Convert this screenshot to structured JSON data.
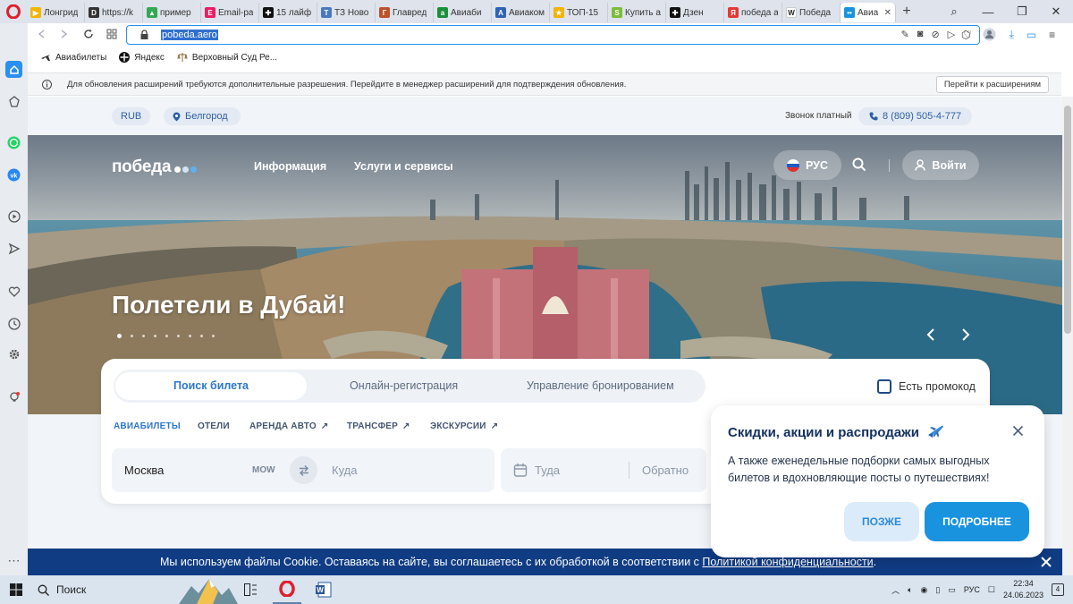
{
  "browser": {
    "tabs": [
      {
        "label": "Лонгрид",
        "icon_color": "#f4b400",
        "glyph": "▶"
      },
      {
        "label": "https://k",
        "icon_color": "#333333",
        "glyph": "D"
      },
      {
        "label": "пример",
        "icon_color": "#34a853",
        "glyph": "▲"
      },
      {
        "label": "Email-ра",
        "icon_color": "#e91e63",
        "glyph": "E"
      },
      {
        "label": "15 лайф",
        "icon_color": "#111111",
        "glyph": "✚"
      },
      {
        "label": "ТЗ Ново",
        "icon_color": "#4a78c0",
        "glyph": "T"
      },
      {
        "label": "Главред",
        "icon_color": "#c0502a",
        "glyph": "Г"
      },
      {
        "label": "Авиаби",
        "icon_color": "#1a8f3c",
        "glyph": "a"
      },
      {
        "label": "Авиаком",
        "icon_color": "#2d62b8",
        "glyph": "A"
      },
      {
        "label": "ТОП-15",
        "icon_color": "#f2b400",
        "glyph": "★"
      },
      {
        "label": "Купить а",
        "icon_color": "#7cbc3b",
        "glyph": "S"
      },
      {
        "label": "Дзен",
        "icon_color": "#111111",
        "glyph": "✚"
      },
      {
        "label": "победа а",
        "icon_color": "#e53935",
        "glyph": "Я"
      },
      {
        "label": "Победа",
        "icon_color": "#ffffff",
        "glyph": "W"
      },
      {
        "label": "Авиа",
        "icon_color": "#1a93df",
        "glyph": "••"
      }
    ],
    "url": "pobeda.aero",
    "bookmarks": [
      "Авиабилеты",
      "Яндекс",
      "Верховный Суд Ре..."
    ],
    "notice": {
      "text": "Для обновления расширений требуются дополнительные разрешения. Перейдите в менеджер расширений для подтверждения обновления.",
      "button": "Перейти к расширениям"
    }
  },
  "site": {
    "currency": "RUB",
    "city": "Белгород",
    "phone_label": "Звонок платный",
    "phone": "8 (809) 505-4-777",
    "logo_text": "победа",
    "nav": {
      "info": "Информация",
      "services": "Услуги и сервисы",
      "lang": "РУС",
      "login": "Войти"
    },
    "headline": "Полетели в Дубай!",
    "search": {
      "tabs": [
        "Поиск билета",
        "Онлайн-регистрация",
        "Управление бронированием"
      ],
      "promo_label": "Есть промокод",
      "categories": [
        "АВИАБИЛЕТЫ",
        "ОТЕЛИ",
        "АРЕНДА АВТО",
        "ТРАНСФЕР",
        "ЭКСКУРСИИ"
      ],
      "from_city": "Москва",
      "from_code": "MOW",
      "to_placeholder": "Куда",
      "depart_placeholder": "Туда",
      "return_placeholder": "Обратно"
    },
    "popup": {
      "title": "Скидки, акции и распродажи",
      "text": "А также еженедельные подборки самых выгодных билетов и вдохновляющие посты о путешествиях!",
      "later": "ПОЗЖЕ",
      "more": "ПОДРОБНЕЕ"
    },
    "cookie": {
      "text": "Мы используем файлы Cookie. Оставаясь на сайте, вы соглашаетесь с их обработкой в соответствии с ",
      "link": "Политикой конфиденциальности",
      "end": "."
    }
  },
  "taskbar": {
    "search": "Поиск",
    "lang": "РУС",
    "time": "22:34",
    "date": "24.06.2023",
    "notif_count": "4"
  }
}
